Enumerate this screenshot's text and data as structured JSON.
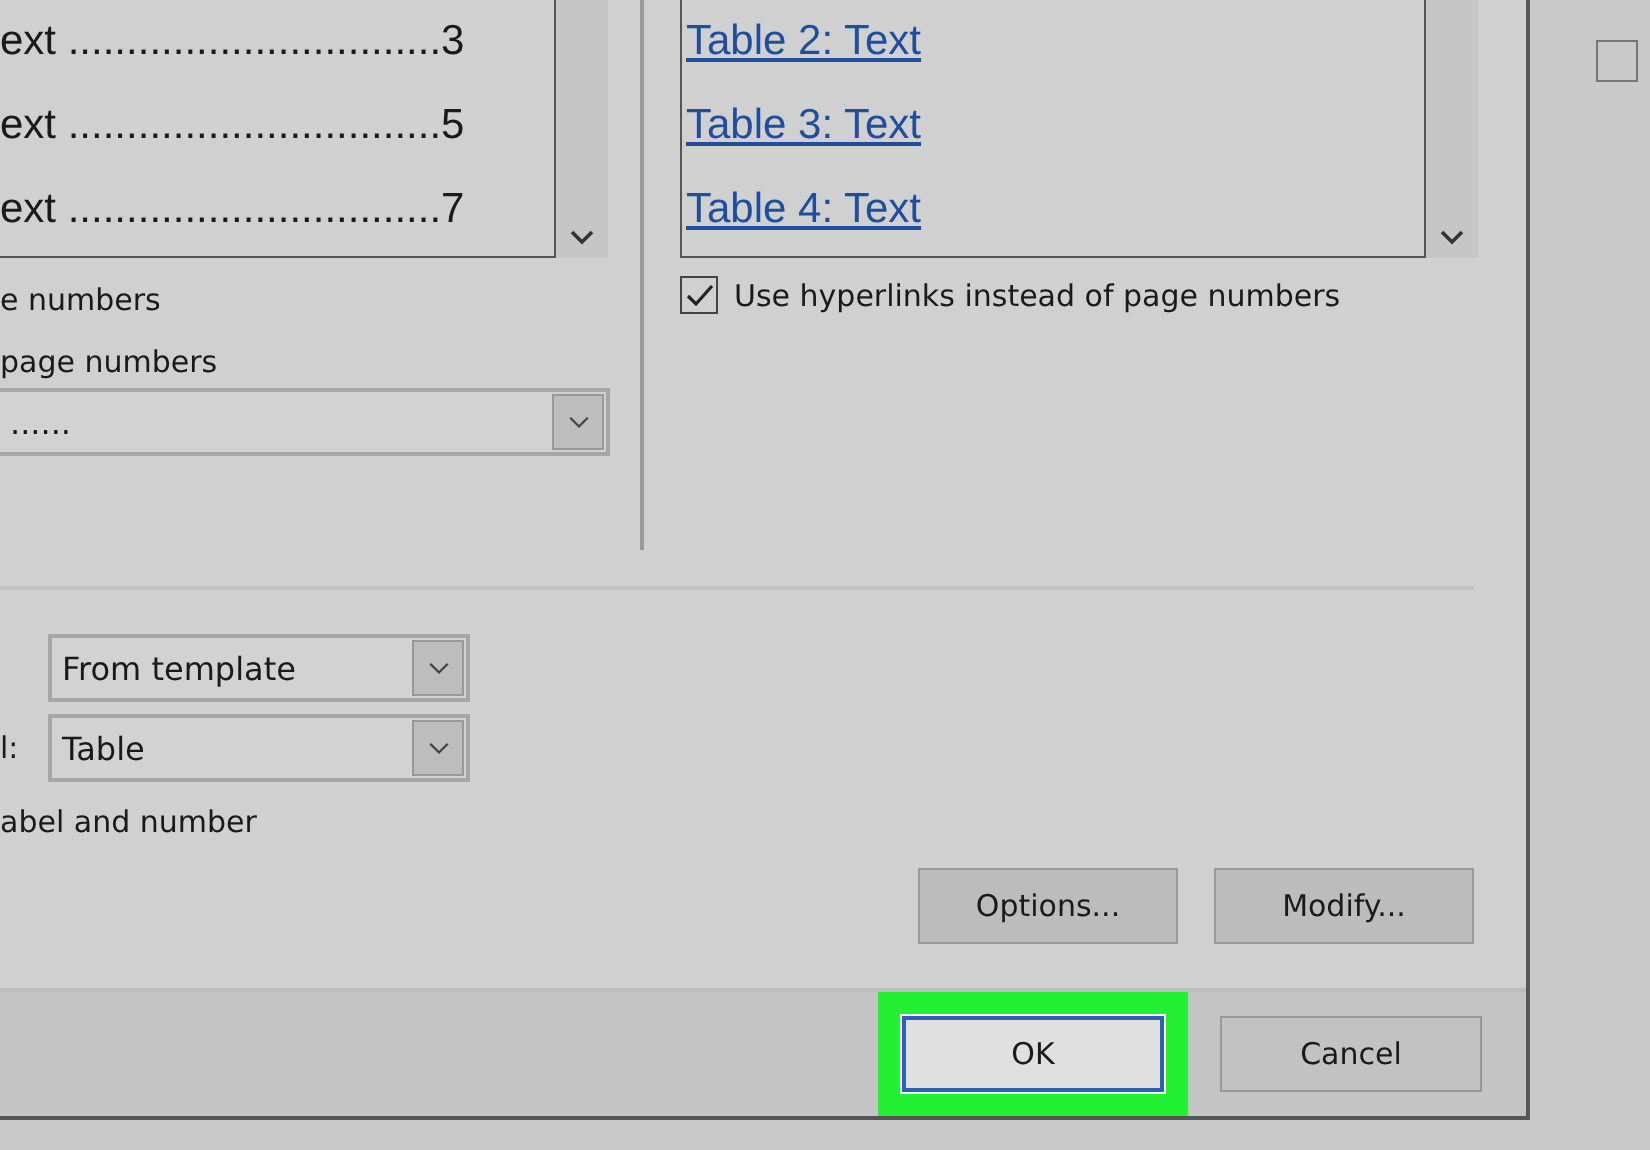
{
  "toc_preview": {
    "entries": [
      {
        "text": "ext ................................3"
      },
      {
        "text": "ext ................................5"
      },
      {
        "text": "ext ................................7"
      }
    ]
  },
  "left_options": {
    "show_page_numbers_label": "e numbers",
    "right_align_label": "page numbers",
    "tab_leader": {
      "value": "......"
    }
  },
  "figures_preview": {
    "links": [
      "Table 2: Text",
      "Table 3: Text",
      "Table 4: Text"
    ]
  },
  "hyperlinks_checkbox": {
    "label": "Use hyperlinks instead of page numbers",
    "checked": true
  },
  "general": {
    "formats": {
      "value": "From template"
    },
    "caption_label": {
      "label": "l:",
      "value": "Table"
    },
    "include_label": "abel and number"
  },
  "buttons": [
    {
      "label": "Options..."
    },
    {
      "label": "Modify..."
    }
  ],
  "footer_buttons": [
    {
      "label": "OK",
      "focused": true,
      "highlighted": true
    },
    {
      "label": "Cancel",
      "focused": false,
      "highlighted": false
    }
  ]
}
